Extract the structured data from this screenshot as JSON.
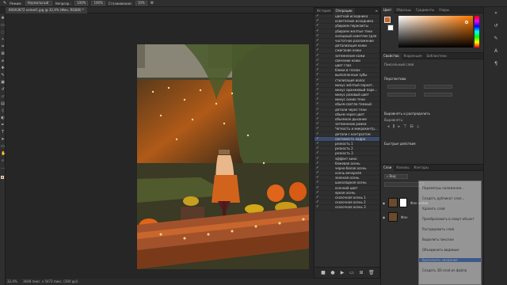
{
  "options_bar": {
    "mode_label": "Режим:",
    "mode_value": "Нормальный",
    "opacity_label": "Непрозр.:",
    "opacity_value": "100%",
    "flow_value": "100%",
    "smoothing_label": "Сглаживание:",
    "smoothing_value": "10%"
  },
  "document": {
    "tab_title": "600A3672 копия1.jpg @ 32,4% (Фон, RGB/8) *"
  },
  "status_bar": {
    "zoom": "32,4%",
    "size": "3648 пикс. x 5472 пикс. (300 ppi)"
  },
  "history_panel": {
    "tabs": [
      "История",
      "Операции"
    ],
    "actions": [
      "цветной исходника",
      "осветление исходника",
      "убираем пересветы",
      "убираем желтые тени",
      "холодный осветлен (для",
      "частотное разложение",
      "детализация кожи",
      "сжигание кожи",
      "затемнение кожи",
      "свечение кожи",
      "цвет глаз",
      "блики в глазах",
      "выполненные зубы",
      "стилизация волос",
      "минус жёлтый паркет..",
      "минус оранжевый парк...",
      "минус розовый цвет",
      "минус синие тени",
      "обьем светло-темный",
      "детали через тени",
      "обьем через цвет",
      "обьемное дыхание",
      "затемнение рамки",
      "Четкость и микроконтр...",
      "детали с контрастом",
      "светимость кадра",
      "резкость 1",
      "резкость 2",
      "резкость 3",
      "эффект кино",
      "бежевая осень",
      "черно-белая осень",
      "осень вечерняя",
      "зеленая осень",
      "шоколадная осень",
      "осенний цвет",
      "яркая осень",
      "сказочная осень 1",
      "сказочная осень 2",
      "сказочная осень 3"
    ],
    "selected_index": 25
  },
  "color_panel": {
    "tabs": [
      "Цвет",
      "Образцы",
      "Градиенты",
      "Узоры"
    ],
    "foreground": "#c86428",
    "background": "#ffffff"
  },
  "properties_panel": {
    "tabs": [
      "Свойства",
      "Коррекция",
      "Библиотеки"
    ],
    "layer_type": "Пиксельный слой",
    "section_transform": "Перспектива",
    "section_align": "Выровнять и распределить",
    "align_label": "Выровнять:",
    "section_quick": "Быстрые действия"
  },
  "layers_panel": {
    "tabs": [
      "Слои",
      "Каналы",
      "Контуры"
    ],
    "kind_label": "Вид",
    "layers": [
      {
        "name": "Фон копия"
      },
      {
        "name": "Фон"
      }
    ]
  },
  "context_menu": {
    "items": [
      "Параметры наложения...",
      "Создать дубликат слоя...",
      "Удалить слой",
      "Преобразовать в смарт-объект",
      "Растрировать слой",
      "Выделить пиксели",
      "Объединить видимые",
      "Выполнить сведение",
      "Создать 3D-слой из файла"
    ],
    "highlighted_index": 7
  }
}
